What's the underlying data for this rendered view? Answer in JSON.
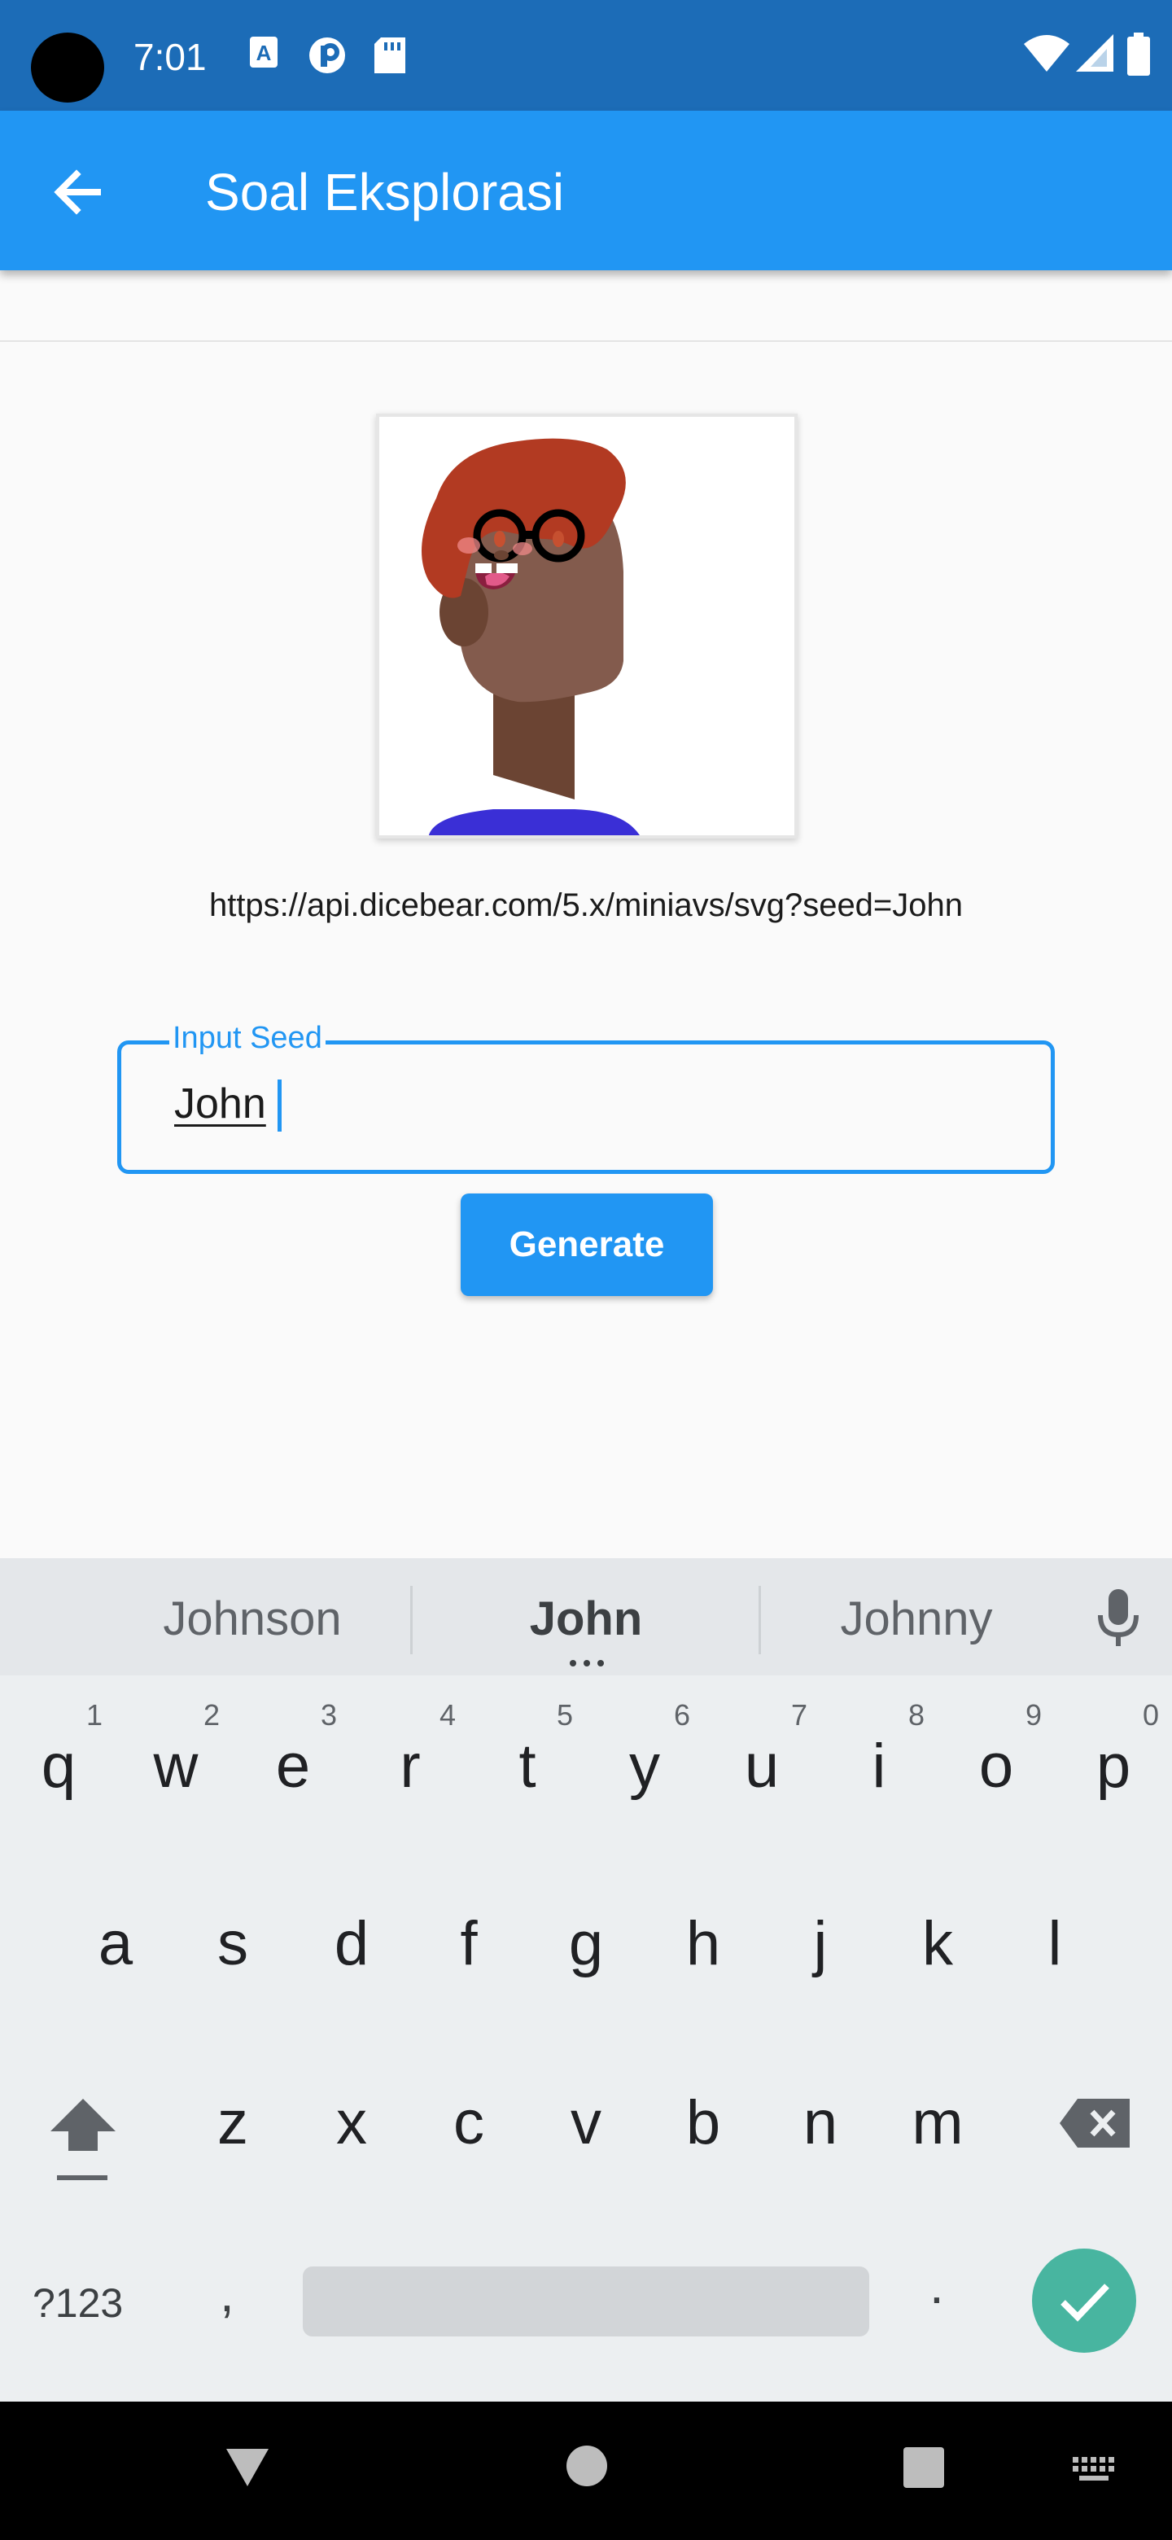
{
  "status_bar": {
    "time": "7:01",
    "icons": [
      "camera-cutout",
      "a-notification-icon",
      "p-notification-icon",
      "sd-card-icon",
      "wifi-icon",
      "signal-icon",
      "battery-icon"
    ]
  },
  "app_bar": {
    "title": "Soal Eksplorasi",
    "back_icon": "arrow-back-icon",
    "color": "#2196f3"
  },
  "avatar": {
    "url": "https://api.dicebear.com/5.x/miniavs/svg?seed=John"
  },
  "seed_input": {
    "label": "Input Seed",
    "value": "John"
  },
  "generate_button": {
    "label": "Generate"
  },
  "keyboard": {
    "suggestions": [
      "Johnson",
      "John",
      "Johnny"
    ],
    "row1": [
      "q",
      "w",
      "e",
      "r",
      "t",
      "y",
      "u",
      "i",
      "o",
      "p"
    ],
    "row1_hints": [
      "1",
      "2",
      "3",
      "4",
      "5",
      "6",
      "7",
      "8",
      "9",
      "0"
    ],
    "row2": [
      "a",
      "s",
      "d",
      "f",
      "g",
      "h",
      "j",
      "k",
      "l"
    ],
    "row3": [
      "z",
      "x",
      "c",
      "v",
      "b",
      "n",
      "m"
    ],
    "symbols_key": "?123",
    "comma_key": ",",
    "period_key": ".",
    "enter_color": "#48b5a0"
  },
  "nav_bar": {
    "icons": [
      "back-triangle-icon",
      "home-circle-icon",
      "recents-square-icon",
      "keyboard-switch-icon"
    ]
  }
}
